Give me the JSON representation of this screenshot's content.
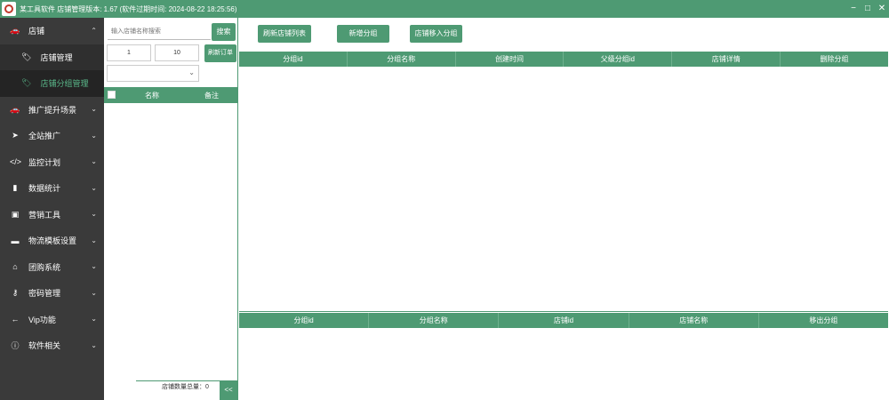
{
  "window": {
    "title": "某工具软件 店铺管理版本: 1.67 (软件过期时间: 2024-08-22 18:25:56)",
    "minimize": "−",
    "maximize": "□",
    "close": "✕"
  },
  "sidebar": {
    "items": [
      {
        "label": "店铺",
        "icon": "shop-icon",
        "glyph": "🚗",
        "chevron": "⌃",
        "expanded": true
      },
      {
        "label": "推广提升场景",
        "icon": "car-icon",
        "glyph": "🚗",
        "chevron": "⌄"
      },
      {
        "label": "全站推广",
        "icon": "send-icon",
        "glyph": "➤",
        "chevron": "⌄"
      },
      {
        "label": "监控计划",
        "icon": "code-icon",
        "glyph": "</>",
        "chevron": "⌄"
      },
      {
        "label": "数据统计",
        "icon": "chart-icon",
        "glyph": "▮",
        "chevron": "⌄"
      },
      {
        "label": "营销工具",
        "icon": "profile-icon",
        "glyph": "▣",
        "chevron": "⌄"
      },
      {
        "label": "物流模板设置",
        "icon": "briefcase-icon",
        "glyph": "▬",
        "chevron": "⌄"
      },
      {
        "label": "团购系统",
        "icon": "bank-icon",
        "glyph": "⌂",
        "chevron": "⌄"
      },
      {
        "label": "密码管理",
        "icon": "key-icon",
        "glyph": "⚷",
        "chevron": "⌄"
      },
      {
        "label": "Vip功能",
        "icon": "arrow-left-icon",
        "glyph": "←",
        "chevron": "⌄"
      },
      {
        "label": "软件相关",
        "icon": "info-icon",
        "glyph": "ⓘ",
        "chevron": "⌄"
      }
    ],
    "subitems": [
      {
        "label": "店铺管理",
        "icon": "tag-icon",
        "glyph": "🏷"
      },
      {
        "label": "店铺分组管理",
        "icon": "tag-icon",
        "glyph": "🏷",
        "active": true
      }
    ]
  },
  "mid": {
    "search_placeholder": "输入店铺名称搜索",
    "search_button": "搜索",
    "page_current": "1",
    "page_size": "10",
    "refresh_button": "刷新订单",
    "select_value": "",
    "select_caret": "⌄",
    "table_headers": {
      "name": "名称",
      "remark": "备注"
    },
    "count_label": "店铺数量总量：0",
    "collapse_label": "<<"
  },
  "right": {
    "buttons": {
      "refresh": "刷新店铺列表",
      "add_group": "新增分组",
      "move_to_group": "店铺移入分组"
    },
    "top_headers": [
      "分组id",
      "分组名称",
      "创建时间",
      "父级分组id",
      "店铺详情",
      "删除分组"
    ],
    "bottom_headers": [
      "分组id",
      "分组名称",
      "店铺id",
      "店铺名称",
      "移出分组"
    ]
  },
  "colors": {
    "accent": "#4e9a73",
    "sidebar_bg": "#3a3a3a",
    "active_text": "#5ab88a"
  }
}
